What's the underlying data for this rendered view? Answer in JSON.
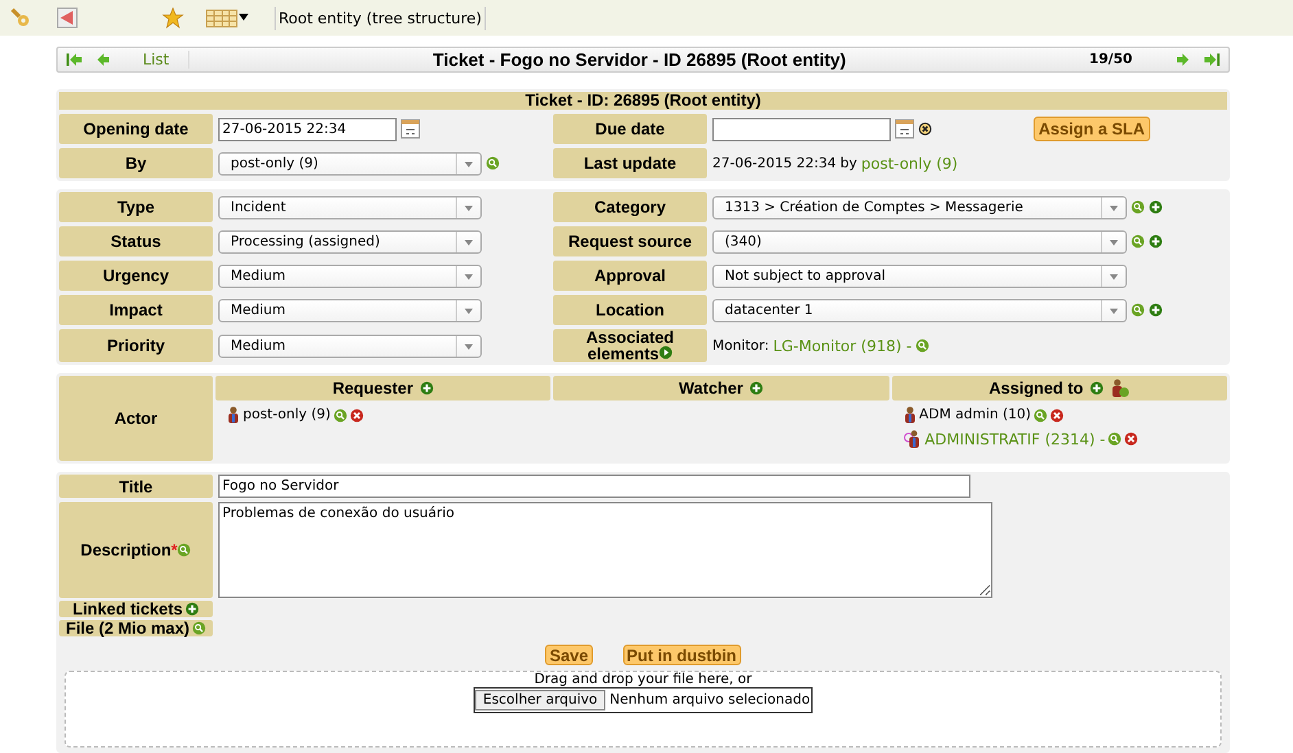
{
  "toolbar": {
    "breadcrumb": "Root entity (tree structure)"
  },
  "nav": {
    "list": "List",
    "title": "Ticket - Fogo no Servidor - ID 26895 (Root entity)",
    "counter": "19/50"
  },
  "header": "Ticket - ID: 26895 (Root entity)",
  "dates": {
    "opening_label": "Opening date",
    "opening_value": "27-06-2015 22:34",
    "due_label": "Due date",
    "sla_button": "Assign a SLA",
    "by_label": "By",
    "by_value": "post-only (9)",
    "update_label": "Last update",
    "update_value": "27-06-2015 22:34",
    "update_by": "by",
    "update_user": "post-only (9)"
  },
  "fields": [
    {
      "label": "Type",
      "value": "Incident",
      "right": {
        "kind": "select",
        "label": "Category",
        "value": "1313 > Création de Comptes > Messagerie",
        "addable": true
      }
    },
    {
      "label": "Status",
      "value": "Processing (assigned)",
      "right": {
        "kind": "select",
        "label": "Request source",
        "value": "(340)",
        "addable": true
      }
    },
    {
      "label": "Urgency",
      "value": "Medium",
      "right": {
        "kind": "select",
        "label": "Approval",
        "value": "Not subject to approval",
        "addable": false
      }
    },
    {
      "label": "Impact",
      "value": "Medium",
      "right": {
        "kind": "select",
        "label": "Location",
        "value": "datacenter 1",
        "addable": true
      }
    },
    {
      "label": "Priority",
      "value": "Medium",
      "right": {
        "kind": "link",
        "label": "Associated elements",
        "prefix": "Monitor:",
        "value": "LG-Monitor (918) -"
      }
    }
  ],
  "actor": {
    "label": "Actor",
    "columns": [
      {
        "title": "Requester",
        "assignable": false,
        "entries": [
          {
            "kind": "user",
            "name": "post-only (9)",
            "link": false
          }
        ]
      },
      {
        "title": "Watcher",
        "assignable": false
      },
      {
        "title": "Assigned to",
        "assignable": true,
        "entries": [
          {
            "kind": "user",
            "name": "ADM admin (10)",
            "link": false
          },
          {
            "kind": "group",
            "name": "ADMINISTRATIF (2314) -",
            "link": true
          }
        ]
      }
    ]
  },
  "title": {
    "label": "Title",
    "value": "Fogo no Servidor"
  },
  "description": {
    "label": "Description",
    "required_mark": "*",
    "value": "Problemas de conexão do usuário"
  },
  "linked": {
    "label": "Linked tickets"
  },
  "file": {
    "label": "File (2 Mio max)"
  },
  "buttons": [
    "Save",
    "Put in dustbin"
  ],
  "dropzone": {
    "text": "Drag and drop your file here, or",
    "choose": "Escolher arquivo",
    "status": "Nenhum arquivo selecionado"
  }
}
